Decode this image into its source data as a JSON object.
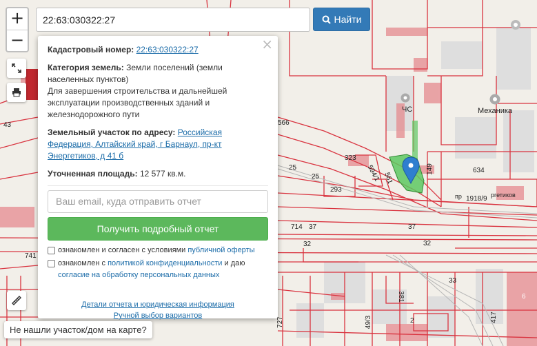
{
  "search": {
    "value": "22:63:030322:27",
    "button_label": "Найти"
  },
  "zoom": {
    "in_label": "+",
    "out_label": "−"
  },
  "popup": {
    "close_label": "×",
    "cadastral_label": "Кадастровый номер:",
    "cadastral_value": "22:63:030322:27",
    "category_label": "Категория земель:",
    "category_value": "Земли поселений (земли населенных пунктов)",
    "purpose": "Для завершения строительства и дальнейшей эксплуатации производственных зданий и железнодорожного пути",
    "address_label": "Земельный участок по адресу:",
    "address_value": "Российская Федерация, Алтайский край, г Барнаул, пр-кт Энергетиков, д 41 б",
    "area_label": "Уточненная площадь:",
    "area_value": "12 577 кв.м.",
    "email_placeholder": "Ваш email, куда отправить отчет",
    "report_button": "Получить подробный отчет",
    "agree1_text": "ознакомлен и согласен с условиями",
    "agree1_link": "публичной оферты",
    "agree2_text": "ознакомлен с",
    "agree2_link": "политикой конфиденциальности",
    "agree2_mid": "и даю",
    "agree2_link2": "согласие на обработку персональных данных",
    "details_link": "Детали отчета и юридическая информация",
    "manual_link": "Ручной выбор вариантов"
  },
  "not_found": "Не нашли участок/дом на карте?",
  "map": {
    "labels": [
      {
        "id": "chs",
        "text": "ЧС"
      },
      {
        "id": "mechanika",
        "text": "Механика"
      },
      {
        "id": "n566",
        "text": "566"
      },
      {
        "id": "n323",
        "text": "323"
      },
      {
        "id": "n594",
        "text": "594/1"
      },
      {
        "id": "n561",
        "text": "561"
      },
      {
        "id": "n149",
        "text": "149"
      },
      {
        "id": "n634",
        "text": "634"
      },
      {
        "id": "n25a",
        "text": "25"
      },
      {
        "id": "n25b",
        "text": "25"
      },
      {
        "id": "n293",
        "text": "293"
      },
      {
        "id": "n1918",
        "text": "1918/9"
      },
      {
        "id": "pr",
        "text": "пр"
      },
      {
        "id": "rgetikov",
        "text": "ргетиков"
      },
      {
        "id": "n714",
        "text": "714"
      },
      {
        "id": "n37a",
        "text": "37"
      },
      {
        "id": "n37b",
        "text": "37"
      },
      {
        "id": "n32a",
        "text": "32"
      },
      {
        "id": "n32b",
        "text": "32"
      },
      {
        "id": "n33",
        "text": "33"
      },
      {
        "id": "n381",
        "text": "381"
      },
      {
        "id": "n6",
        "text": "6"
      },
      {
        "id": "n741",
        "text": "741"
      },
      {
        "id": "n43",
        "text": "43"
      },
      {
        "id": "n2",
        "text": "2"
      },
      {
        "id": "n417",
        "text": "417"
      },
      {
        "id": "n49",
        "text": "49/3"
      },
      {
        "id": "n727",
        "text": "727"
      }
    ]
  },
  "colors": {
    "parcel_line": "#d9333f",
    "selected_parcel": "#5ec862",
    "marker": "#2f7fcf",
    "search_button": "#337ab7",
    "report_button": "#5cb85c"
  }
}
